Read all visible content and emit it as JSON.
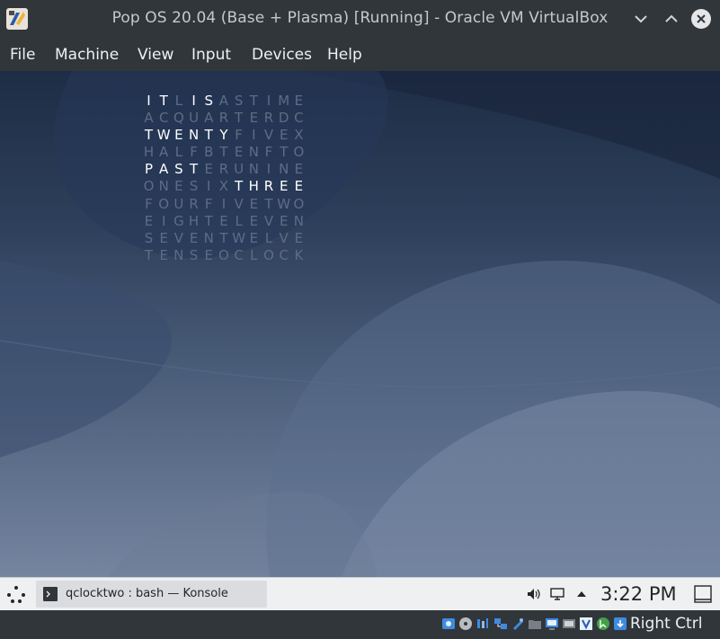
{
  "window": {
    "title": "Pop OS 20.04 (Base + Plasma) [Running] - Oracle VM VirtualBox"
  },
  "menu": {
    "items": [
      "File",
      "Machine",
      "View",
      "Input",
      "Devices",
      "Help"
    ]
  },
  "word_clock": {
    "rows": [
      "ITLISASTIME",
      "ACQUARTERDC",
      "TWENTYFIVEX",
      "HALFBTENFTO",
      "PASTERUNINE",
      "ONESIXTHREE",
      "FOURFIVETWO",
      "EIGHTELEVEN",
      "SEVENTWELVE",
      "TENSEOCLOCK"
    ],
    "lit": [
      [
        0,
        0
      ],
      [
        0,
        1
      ],
      [
        0,
        3
      ],
      [
        0,
        4
      ],
      [
        2,
        0
      ],
      [
        2,
        1
      ],
      [
        2,
        2
      ],
      [
        2,
        3
      ],
      [
        2,
        4
      ],
      [
        2,
        5
      ],
      [
        4,
        0
      ],
      [
        4,
        1
      ],
      [
        4,
        2
      ],
      [
        4,
        3
      ],
      [
        5,
        6
      ],
      [
        5,
        7
      ],
      [
        5,
        8
      ],
      [
        5,
        9
      ],
      [
        5,
        10
      ]
    ],
    "lit_color": "#ffffff",
    "dim_color": "#5e6c84"
  },
  "panel": {
    "task_label": "qclocktwo : bash — Konsole",
    "clock": "3:22 PM",
    "tray_icons": [
      "volume-icon",
      "display-icon",
      "expand-tray-icon"
    ]
  },
  "statusbar": {
    "host_key": "Right Ctrl",
    "icons": [
      "hard-disk-icon",
      "optical-drive-icon",
      "audio-icon",
      "network-icon",
      "usb-icon",
      "shared-folders-icon",
      "display-icon",
      "recording-icon",
      "virtualization-icon",
      "mouse-integration-icon",
      "keyboard-capture-icon"
    ]
  },
  "colors": {
    "chrome": "#31363b",
    "panel": "#eff0f1"
  }
}
